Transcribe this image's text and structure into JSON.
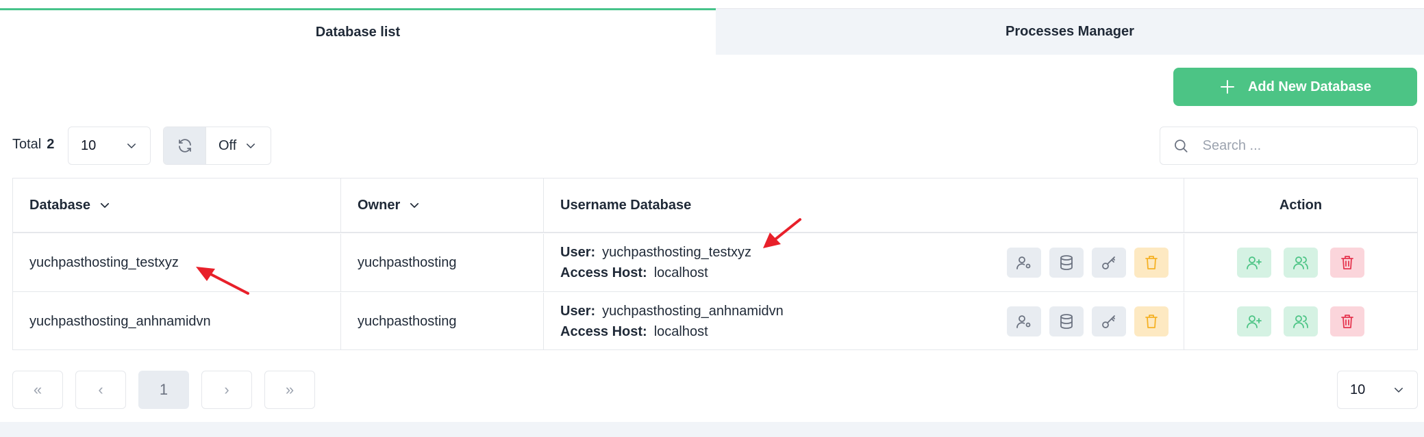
{
  "tabs": [
    {
      "label": "Database list",
      "active": true
    },
    {
      "label": "Processes Manager",
      "active": false
    }
  ],
  "toolbar": {
    "add_label": "Add New Database",
    "total_label": "Total",
    "total_count": "2",
    "per_page": "10",
    "auto_refresh": "Off",
    "search_placeholder": "Search ..."
  },
  "table": {
    "headers": {
      "database": "Database",
      "owner": "Owner",
      "username": "Username Database",
      "action": "Action"
    },
    "user_label": "User:",
    "host_label": "Access Host:",
    "rows": [
      {
        "database": "yuchpasthosting_testxyz",
        "owner": "yuchpasthosting",
        "user": "yuchpasthosting_testxyz",
        "host": "localhost"
      },
      {
        "database": "yuchpasthosting_anhnamidvn",
        "owner": "yuchpasthosting",
        "user": "yuchpasthosting_anhnamidvn",
        "host": "localhost"
      }
    ]
  },
  "pagination": {
    "first": "«",
    "prev": "‹",
    "current": "1",
    "next": "›",
    "last": "»",
    "page_size": "10"
  },
  "colors": {
    "accent": "#4cc485",
    "annotation_arrow": "#e8202a"
  },
  "icons": [
    "plus-icon",
    "chevron-down-icon",
    "refresh-icon",
    "search-icon",
    "user-settings-icon",
    "database-icon",
    "key-icon",
    "trash-icon",
    "user-plus-icon",
    "users-icon",
    "arrow-annotation"
  ]
}
